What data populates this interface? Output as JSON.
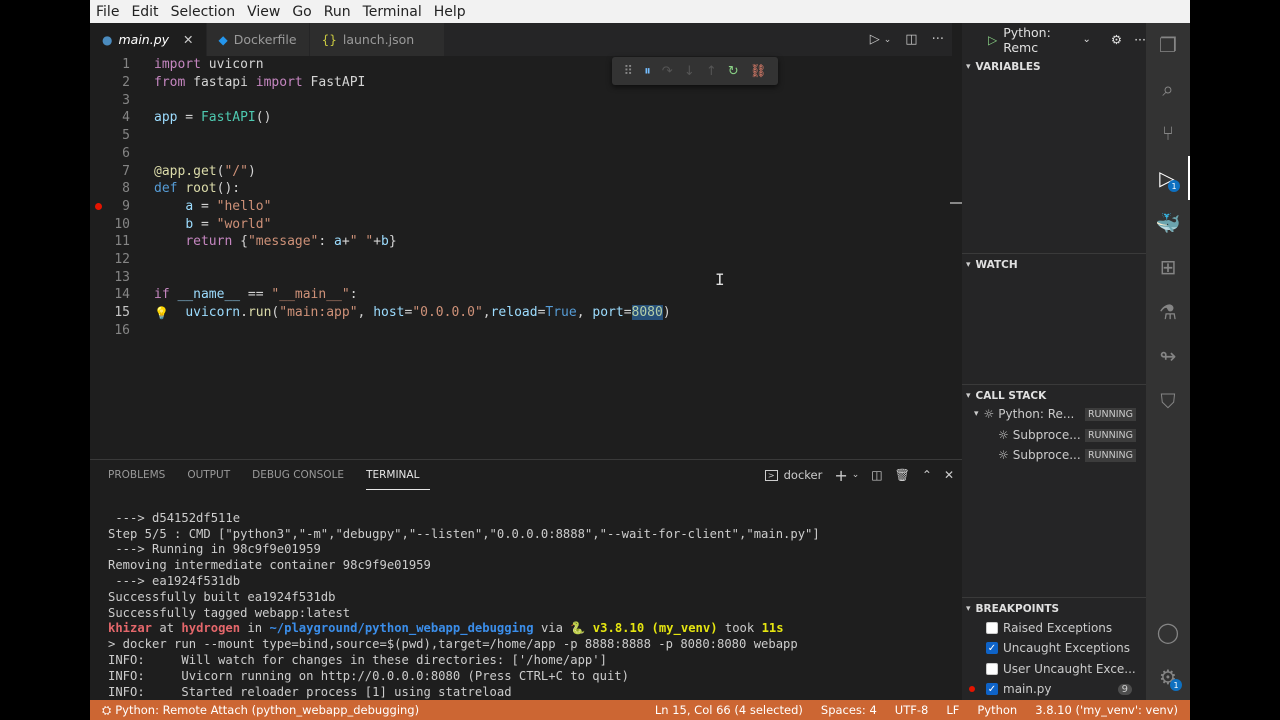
{
  "menubar": [
    "File",
    "Edit",
    "Selection",
    "View",
    "Go",
    "Run",
    "Terminal",
    "Help"
  ],
  "tabs": [
    {
      "label": "main.py",
      "icon": "python-icon",
      "active": true
    },
    {
      "label": "Dockerfile",
      "icon": "docker-icon",
      "active": false
    },
    {
      "label": "launch.json",
      "icon": "json-icon",
      "active": false
    }
  ],
  "editor": {
    "lines": [
      {
        "n": "1",
        "html": "<span class='kw2'>import</span> uvicorn"
      },
      {
        "n": "2",
        "html": "<span class='kw2'>from</span> fastapi <span class='kw2'>import</span> FastAPI"
      },
      {
        "n": "3",
        "html": ""
      },
      {
        "n": "4",
        "html": "<span class='var'>app</span> = <span class='cls'>FastAPI</span>()"
      },
      {
        "n": "5",
        "html": ""
      },
      {
        "n": "6",
        "html": ""
      },
      {
        "n": "7",
        "html": "<span class='fn'>@app.get</span>(<span class='str'>\"/\"</span>)"
      },
      {
        "n": "8",
        "html": "<span class='kw'>def</span> <span class='fn'>root</span>():"
      },
      {
        "n": "9",
        "html": "    <span class='var'>a</span> = <span class='str'>\"hello\"</span>"
      },
      {
        "n": "10",
        "html": "    <span class='var'>b</span> = <span class='str'>\"world\"</span>"
      },
      {
        "n": "11",
        "html": "    <span class='kw2'>return</span> {<span class='str'>\"message\"</span>: <span class='var'>a</span>+<span class='str'>\" \"</span>+<span class='var'>b</span>}"
      },
      {
        "n": "12",
        "html": ""
      },
      {
        "n": "13",
        "html": ""
      },
      {
        "n": "14",
        "html": "<span class='kw2'>if</span> <span class='var'>__name__</span> == <span class='str'>\"__main__\"</span>:"
      },
      {
        "n": "15",
        "html": "    <span class='var'>uvicorn</span>.<span class='fn'>run</span>(<span class='str'>\"main:app\"</span>, <span class='var'>host</span>=<span class='str'>\"0.0.0.0\"</span>,<span class='var'>reload</span>=<span class='kw'>True</span>, <span class='var'>port</span>=<span class='num sel'>8080</span>)"
      },
      {
        "n": "16",
        "html": ""
      }
    ],
    "current_line": "15",
    "breakpoint_line": "9"
  },
  "debug": {
    "config_name": "Python: Remc",
    "sections": {
      "variables": "VARIABLES",
      "watch": "WATCH",
      "call_stack": "CALL STACK",
      "breakpoints": "BREAKPOINTS"
    },
    "call_stack": [
      {
        "label": "Python: Re...",
        "status": "RUNNING",
        "indent": 1
      },
      {
        "label": "Subproce...",
        "status": "RUNNING",
        "indent": 2
      },
      {
        "label": "Subproce...",
        "status": "RUNNING",
        "indent": 2
      }
    ],
    "breakpoints": [
      {
        "label": "Raised Exceptions",
        "checked": false
      },
      {
        "label": "Uncaught Exceptions",
        "checked": true
      },
      {
        "label": "User Uncaught Exce...",
        "checked": false
      },
      {
        "label": "main.py",
        "checked": true,
        "count": "9"
      }
    ]
  },
  "panel": {
    "tabs": [
      "PROBLEMS",
      "OUTPUT",
      "DEBUG CONSOLE",
      "TERMINAL"
    ],
    "active_tab": "TERMINAL",
    "terminal_name": "docker",
    "terminal_lines": [
      " ---> d54152df511e",
      "Step 5/5 : CMD [\"python3\",\"-m\",\"debugpy\",\"--listen\",\"0.0.0.0:8888\",\"--wait-for-client\",\"main.py\"]",
      " ---> Running in 98c9f9e01959",
      "Removing intermediate container 98c9f9e01959",
      " ---> ea1924f531db",
      "Successfully built ea1924f531db",
      "Successfully tagged webapp:latest"
    ],
    "prompt": {
      "user": "khizar",
      "at": " at ",
      "host": "hydrogen",
      "in": " in ",
      "path": "~/playground/python_webapp_debugging",
      "via": " via ",
      "py": "🐍 v3.8.10 (my_venv)",
      "took": " took ",
      "dur": "11s"
    },
    "after_prompt": [
      "> docker run --mount type=bind,source=$(pwd),target=/home/app -p 8888:8888 -p 8080:8080 webapp",
      "INFO:     Will watch for changes in these directories: ['/home/app']",
      "INFO:     Uvicorn running on http://0.0.0.0:8080 (Press CTRL+C to quit)",
      "INFO:     Started reloader process [1] using statreload"
    ]
  },
  "status": {
    "left": "Python: Remote Attach (python_webapp_debugging)",
    "position": "Ln 15, Col 66 (4 selected)",
    "spaces": "Spaces: 4",
    "encoding": "UTF-8",
    "eol": "LF",
    "language": "Python",
    "interpreter": "3.8.10 ('my_venv': venv)"
  },
  "colors": {
    "status_bg": "#cc6633",
    "editor_bg": "#1e1e1e",
    "breakpoint": "#e51400"
  }
}
